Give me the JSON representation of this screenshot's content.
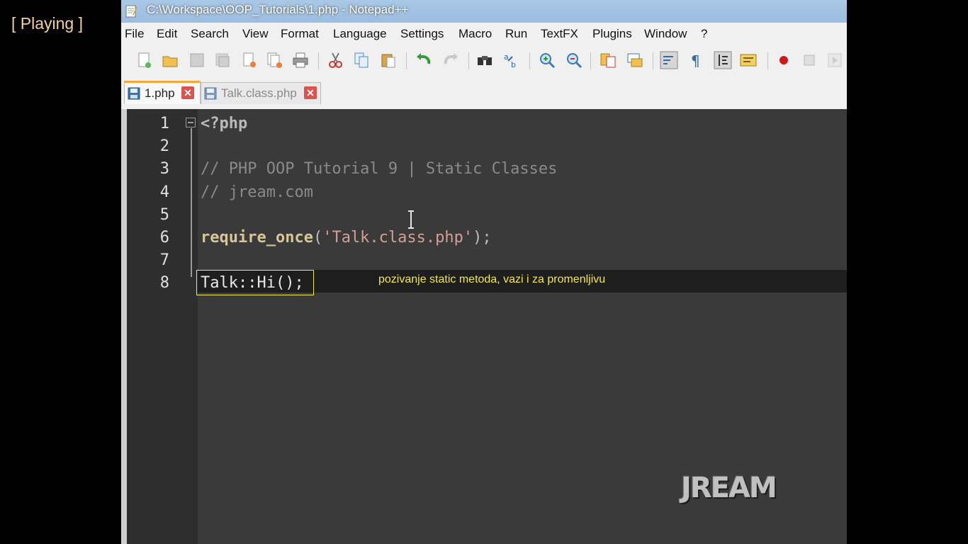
{
  "player": {
    "status": "[ Playing ]"
  },
  "window": {
    "title": "C:\\Workspace\\OOP_Tutorials\\1.php - Notepad++"
  },
  "menu": [
    "File",
    "Edit",
    "Search",
    "View",
    "Format",
    "Language",
    "Settings",
    "Macro",
    "Run",
    "TextFX",
    "Plugins",
    "Window",
    "?"
  ],
  "toolbar": {
    "icons": [
      "new-file-icon",
      "open-file-icon",
      "save-icon",
      "save-all-icon",
      "close-icon",
      "close-all-icon",
      "print-icon",
      "cut-icon",
      "copy-icon",
      "paste-icon",
      "undo-icon",
      "redo-icon",
      "find-icon",
      "replace-icon",
      "zoom-in-icon",
      "zoom-out-icon",
      "sync-vertical-icon",
      "sync-horizontal-icon",
      "word-wrap-icon",
      "show-all-chars-icon",
      "indent-guide-icon",
      "user-lang-icon",
      "record-macro-icon",
      "stop-macro-icon",
      "play-macro-icon"
    ]
  },
  "tabs": [
    {
      "label": "1.php",
      "active": true
    },
    {
      "label": "Talk.class.php",
      "active": false
    }
  ],
  "editor": {
    "line_numbers": [
      "1",
      "2",
      "3",
      "4",
      "5",
      "6",
      "7",
      "8"
    ],
    "lines": {
      "l1": "<?php",
      "l3": "// PHP OOP Tutorial 9 | Static Classes",
      "l4": "// jream.com",
      "l6_func": "require_once",
      "l6_open": "(",
      "l6_str": "'Talk.class.php'",
      "l6_close": ");",
      "l8": "Talk::Hi();"
    }
  },
  "annotation": {
    "text": "pozivanje static metoda, vazi i za promenljivu"
  },
  "watermark": {
    "text": "JREAM"
  },
  "colors": {
    "annotation": "#f5e64b",
    "status": "#f5d29b",
    "editor_bg": "#3a3a3a"
  }
}
